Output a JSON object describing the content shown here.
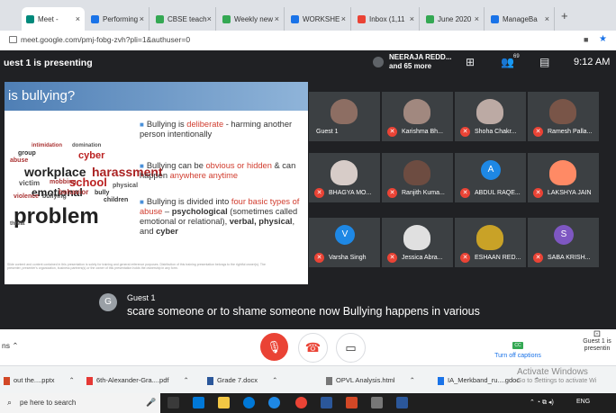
{
  "browser": {
    "tabs": [
      {
        "label": "Meet -",
        "color": "#00897b",
        "active": true
      },
      {
        "label": "Performing",
        "color": "#1a73e8"
      },
      {
        "label": "CBSE teach",
        "color": "#34a853"
      },
      {
        "label": "Weekly new",
        "color": "#34a853"
      },
      {
        "label": "WORKSHE",
        "color": "#1a73e8"
      },
      {
        "label": "Inbox (1,11",
        "color": "#ea4335"
      },
      {
        "label": "June 2020",
        "color": "#34a853"
      },
      {
        "label": "ManageBa",
        "color": "#1a73e8"
      }
    ],
    "url": "meet.google.com/pmj-fobg-zvh?pli=1&authuser=0"
  },
  "meet": {
    "presenting_label": "uest 1 is presenting",
    "presenter_name": "NEERAJA REDD...",
    "presenter_more": "and 65 more",
    "participants_count": "69",
    "time": "9:12 AM"
  },
  "slide": {
    "title": "is bullying?",
    "bullets": [
      {
        "parts": [
          {
            "t": "Bullying is "
          },
          {
            "t": "deliberate",
            "red": true
          },
          {
            "t": " - harming another person intentionally"
          }
        ]
      },
      {
        "parts": [
          {
            "t": "Bullying can be "
          },
          {
            "t": "obvious or hidden",
            "red": true
          },
          {
            "t": " & can happen "
          },
          {
            "t": "anywhere anytime",
            "red": true
          }
        ]
      },
      {
        "parts": [
          {
            "t": "Bullying is divided into "
          },
          {
            "t": "four basic types of abuse",
            "red": true
          },
          {
            "t": " – "
          },
          {
            "t": "psychological",
            "bold": true
          },
          {
            "t": " (sometimes called emotional or relational), "
          },
          {
            "t": "verbal, physical",
            "bold": true
          },
          {
            "t": ", and "
          },
          {
            "t": "cyber",
            "bold": true
          }
        ]
      }
    ],
    "wordcloud": [
      "intimidation",
      "domination",
      "group",
      "cyber",
      "abuse",
      "workplace",
      "harassment",
      "victim",
      "school",
      "emotional",
      "behavior",
      "bully",
      "violence",
      "problem",
      "threat",
      "bullying",
      "children",
      "mobbing",
      "physical"
    ],
    "footer": "Slide content and content contained in this presentation is solely for training and general reference purposes. Distribution of this training presentation belongs to the rightful owner(s). The presenter, presenter's organization, business partners(s) or the owner of this presentation holds the ownership in any form."
  },
  "participants": [
    {
      "name": "Guest 1",
      "kind": "face",
      "face": "#8d6e63",
      "muted": false
    },
    {
      "name": "Karishma Bh...",
      "kind": "face",
      "face": "#a1887f",
      "muted": true
    },
    {
      "name": "Shoha Chakr...",
      "kind": "face",
      "face": "#bcaaa4",
      "muted": true
    },
    {
      "name": "Ramesh Palla...",
      "kind": "face",
      "face": "#795548",
      "muted": true
    },
    {
      "name": "BHAGYA MO...",
      "kind": "face",
      "face": "#d7ccc8",
      "muted": true
    },
    {
      "name": "Ranjith Kuma...",
      "kind": "face",
      "face": "#6d4c41",
      "muted": true
    },
    {
      "name": "ABDUL RAQE...",
      "kind": "avatar",
      "letter": "A",
      "color": "#1e88e5",
      "muted": true
    },
    {
      "name": "LAKSHYA JAIN",
      "kind": "face",
      "face": "#ff8a65",
      "muted": true
    },
    {
      "name": "Varsha Singh",
      "kind": "avatar",
      "letter": "V",
      "color": "#1e88e5",
      "muted": true
    },
    {
      "name": "Jessica Abra...",
      "kind": "face",
      "face": "#e0e0e0",
      "muted": true
    },
    {
      "name": "ESHAAN RED...",
      "kind": "face",
      "face": "#c9a227",
      "muted": true
    },
    {
      "name": "SABA KRISH...",
      "kind": "avatar",
      "letter": "S",
      "color": "#7e57c2",
      "muted": true
    }
  ],
  "caption": {
    "avatar": "G",
    "speaker": "Guest 1",
    "text": "scare someone or to shame someone now Bullying happens in various"
  },
  "controls": {
    "presentation": "ns",
    "captions_label": "Turn off captions",
    "present_label": "Guest 1 is presentin"
  },
  "downloads": [
    "out the....pptx",
    "6th-Alexander-Gra....pdf",
    "Grade 7.docx",
    "OPVL Analysis.html",
    "IA_Merkband_ru....gdoc"
  ],
  "activate": {
    "line1": "Activate Windows",
    "line2": "Go to Settings to activate Wi"
  },
  "taskbar": {
    "search_placeholder": "pe here to search",
    "lang": "ENG"
  }
}
